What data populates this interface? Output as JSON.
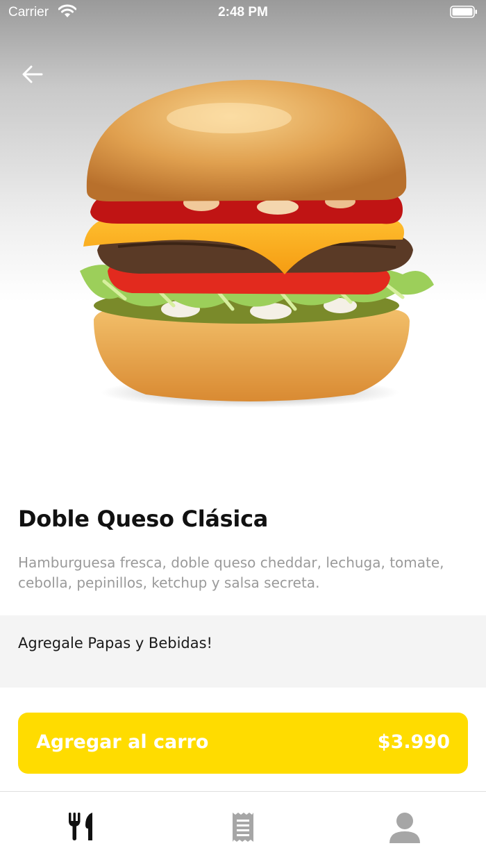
{
  "status_bar": {
    "carrier": "Carrier",
    "time": "2:48 PM"
  },
  "product": {
    "name": "Doble Queso Clásica",
    "description": "Hamburguesa fresca, doble queso cheddar, lechuga, tomate, cebolla, pepinillos, ketchup y salsa secreta."
  },
  "extras": {
    "label": "Agregale Papas y Bebidas!"
  },
  "cart_button": {
    "label": "Agregar al carro",
    "price": "$3.990"
  },
  "tab_bar": {
    "tabs": [
      {
        "icon": "fork-knife-icon",
        "active": true
      },
      {
        "icon": "receipt-icon",
        "active": false
      },
      {
        "icon": "user-icon",
        "active": false
      }
    ]
  },
  "colors": {
    "accent": "#ffdc00",
    "text_primary": "#111111",
    "text_secondary": "#9a9a9a",
    "icon_active": "#111111",
    "icon_inactive": "#a6a6a6"
  }
}
